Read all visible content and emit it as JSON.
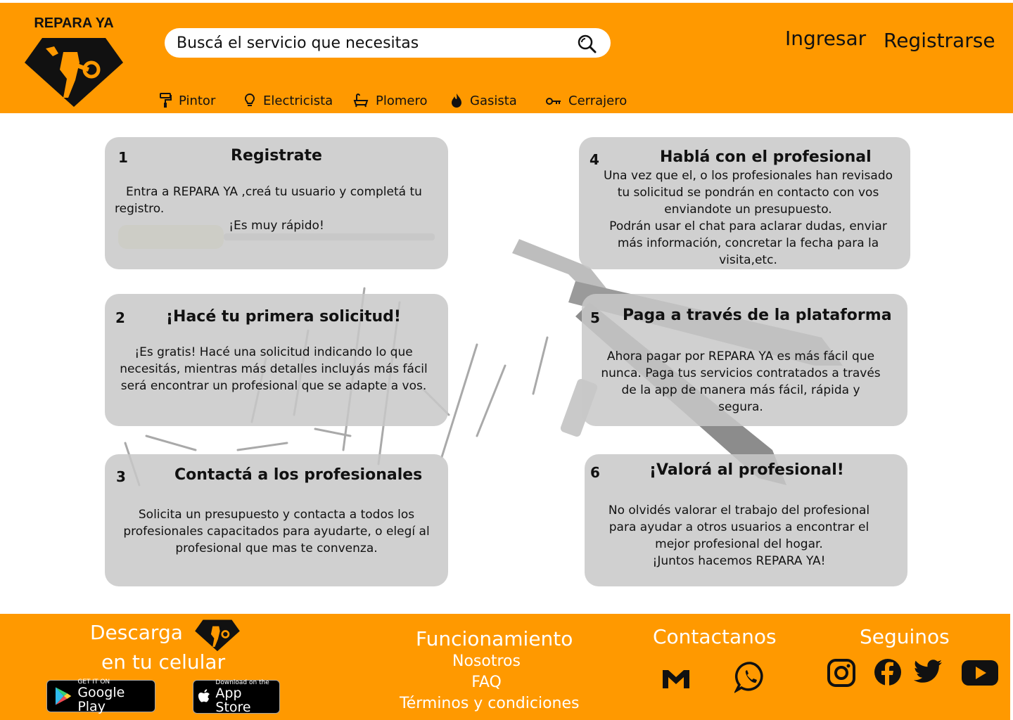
{
  "brand": {
    "logo_text": "REPARA YA"
  },
  "colors": {
    "accent": "#FF9900",
    "card_bg": "#C8C8C8",
    "text": "#111111"
  },
  "search": {
    "placeholder": "Buscá el servicio que necesitas",
    "icon": "search-icon"
  },
  "auth": {
    "login": "Ingresar",
    "register": "Registrarse"
  },
  "nav": {
    "items": [
      {
        "label": "Pintor",
        "icon": "paint-roller-icon"
      },
      {
        "label": "Electricista",
        "icon": "lightbulb-icon"
      },
      {
        "label": "Plomero",
        "icon": "bathtub-icon"
      },
      {
        "label": "Gasista",
        "icon": "flame-icon"
      },
      {
        "label": "Cerrajero",
        "icon": "key-icon"
      }
    ]
  },
  "steps": [
    {
      "num": "1",
      "title": "Registrate",
      "body": [
        "Entra a REPARA YA ,creá tu usuario y completá tu registro.",
        "¡Es muy rápido!"
      ]
    },
    {
      "num": "2",
      "title": "¡Hacé tu primera solicitud!",
      "body": [
        "¡Es gratis! Hacé una solicitud indicando lo que necesitás, mientras más detalles incluyás más fácil será encontrar un profesional que se adapte a vos."
      ]
    },
    {
      "num": "3",
      "title": "Contactá a los profesionales",
      "body": [
        "Solicita un presupuesto y contacta a todos los profesionales capacitados para ayudarte, o elegí al profesional que mas te convenza."
      ]
    },
    {
      "num": "4",
      "title": "Hablá con el profesional",
      "body": [
        "Una vez que el, o los profesionales han revisado tu solicitud se pondrán en contacto con vos enviandote un presupuesto.",
        "Podrán usar el chat para aclarar dudas, enviar más información, concretar la fecha para la visita,etc."
      ]
    },
    {
      "num": "5",
      "title": "Paga a través de la plataforma",
      "body": [
        "Ahora pagar por REPARA YA es más fácil que nunca. Paga tus servicios contratados a través de la app de manera más fácil, rápida y segura."
      ]
    },
    {
      "num": "6",
      "title": "¡Valorá al profesional!",
      "body": [
        "No olvidés valorar el trabajo del profesional para ayudar a otros usuarios a encontrar el mejor profesional del hogar.",
        "¡Juntos hacemos REPARA YA!"
      ]
    }
  ],
  "footer": {
    "download_line1": "Descarga",
    "download_line2": "en tu celular",
    "google_play_small": "GET IT ON",
    "google_play_big": "Google Play",
    "app_store_small": "Download on the",
    "app_store_big": "App Store",
    "info_heading": "Funcionamiento",
    "links": [
      "Nosotros",
      "FAQ",
      "Términos y condiciones"
    ],
    "contact_heading": "Contactanos",
    "contact_icons": [
      "gmail-icon",
      "whatsapp-icon"
    ],
    "follow_heading": "Seguinos",
    "social_icons": [
      "instagram-icon",
      "facebook-icon",
      "twitter-icon",
      "youtube-icon"
    ]
  }
}
